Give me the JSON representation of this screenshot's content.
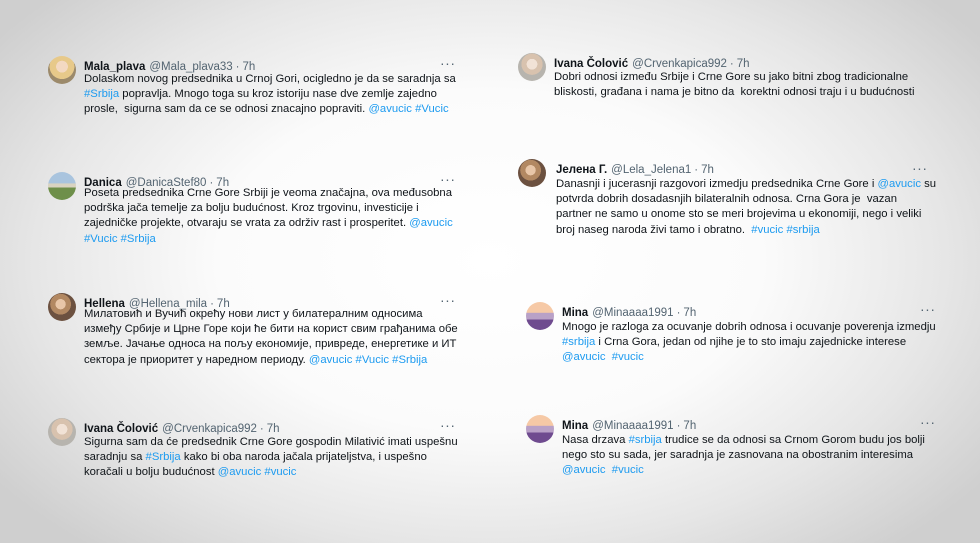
{
  "tweets": [
    {
      "name": "Mala_plava",
      "handle": "@Mala_plava33",
      "time": "7h",
      "avatar": "avatar-blonde",
      "lines": [
        [
          {
            "t": "Dolaskom novog predsednika u Crnoj Gori, ocigledno je da se saradnja sa"
          }
        ],
        [
          {
            "t": "#Srbija",
            "link": true
          },
          {
            "t": " popravlja. Mnogo toga su kroz istoriju nase dve zemlje zajedno"
          }
        ],
        [
          {
            "t": "prosle,  sigurna sam da ce se odnosi znacajno popraviti. "
          },
          {
            "t": "@avucic",
            "link": true
          },
          {
            "t": " "
          },
          {
            "t": "#Vucic",
            "link": true
          }
        ]
      ]
    },
    {
      "name": "Danica",
      "handle": "@DanicaStef80",
      "time": "7h",
      "avatar": "avatar-landscape",
      "lines": [
        [
          {
            "t": "Poseta predsednika Crne Gore Srbiji je veoma značajna, ova međusobna"
          }
        ],
        [
          {
            "t": "podrška jača temelje za bolju budućnost. Kroz trgovinu, investicije i"
          }
        ],
        [
          {
            "t": "zajedničke projekte, otvaraju se vrata za održiv rast i prosperitet. "
          },
          {
            "t": "@avucic",
            "link": true
          }
        ],
        [
          {
            "t": "#Vucic",
            "link": true
          },
          {
            "t": " "
          },
          {
            "t": "#Srbija",
            "link": true
          }
        ]
      ]
    },
    {
      "name": "Hellena",
      "handle": "@Hellena_mila",
      "time": "7h",
      "avatar": "avatar-photo",
      "lines": [
        [
          {
            "t": "Милатовић и Вучић окрећу нови лист у билатералним односима"
          }
        ],
        [
          {
            "t": "између Србије и Црне Горе који ће бити на корист свим грађанима обе"
          }
        ],
        [
          {
            "t": "земље. Јачање односа на пољу економије, привреде, енергетике и ИТ"
          }
        ],
        [
          {
            "t": "сектора је приоритет у наредном периоду. "
          },
          {
            "t": "@avucic",
            "link": true
          },
          {
            "t": " "
          },
          {
            "t": "#Vucic",
            "link": true
          },
          {
            "t": " "
          },
          {
            "t": "#Srbija",
            "link": true
          }
        ]
      ]
    },
    {
      "name": "Ivana Čolović",
      "handle": "@Crvenkapica992",
      "time": "7h",
      "avatar": "avatar-gray",
      "lines": [
        [
          {
            "t": "Sigurna sam da će predsednik Crne Gore gospodin Milativić imati uspešnu"
          }
        ],
        [
          {
            "t": "saradnju sa "
          },
          {
            "t": "#Srbija",
            "link": true
          },
          {
            "t": " kako bi oba naroda jačala prijateljstva, i uspešno"
          }
        ],
        [
          {
            "t": "koračali u bolju budućnost "
          },
          {
            "t": "@avucic",
            "link": true
          },
          {
            "t": " "
          },
          {
            "t": "#vucic",
            "link": true
          }
        ]
      ]
    },
    {
      "name": "Ivana Čolović",
      "handle": "@Crvenkapica992",
      "time": "7h",
      "avatar": "avatar-gray",
      "lines": [
        [
          {
            "t": "Dobri odnosi između Srbije i Crne Gore su jako bitni zbog tradicionalne"
          }
        ],
        [
          {
            "t": "bliskosti, građana i nama je bitno da  korektni odnosi traju i u budućnosti"
          }
        ]
      ]
    },
    {
      "name": "Јелена Г.",
      "handle": "@Lela_Jelena1",
      "time": "7h",
      "avatar": "avatar-photo",
      "lines": [
        [
          {
            "t": "Danasnji i jucerasnji razgovori izmedju predsednika Crne Gore i "
          },
          {
            "t": "@avucic",
            "link": true
          },
          {
            "t": " su"
          }
        ],
        [
          {
            "t": "potvrda dobrih dosadasnjih bilateralnih odnosa. Crna Gora je  vazan"
          }
        ],
        [
          {
            "t": "partner ne samo u onome sto se meri brojevima u ekonomiji, nego i veliki"
          }
        ],
        [
          {
            "t": "broj naseg naroda živi tamo i obratno.  "
          },
          {
            "t": "#vucic",
            "link": true
          },
          {
            "t": " "
          },
          {
            "t": "#srbija",
            "link": true
          }
        ]
      ]
    },
    {
      "name": "Mina",
      "handle": "@Minaaaa1991",
      "time": "7h",
      "avatar": "avatar-lavender",
      "lines": [
        [
          {
            "t": "Mnogo je razloga za ocuvanje dobrih odnosa i ocuvanje poverenja izmedju"
          }
        ],
        [
          {
            "t": "#srbija",
            "link": true
          },
          {
            "t": " i Crna Gora, jedan od njihe je to sto imaju zajednicke interese"
          }
        ],
        [
          {
            "t": "@avucic",
            "link": true
          },
          {
            "t": "  "
          },
          {
            "t": "#vucic",
            "link": true
          }
        ]
      ]
    },
    {
      "name": "Mina",
      "handle": "@Minaaaa1991",
      "time": "7h",
      "avatar": "avatar-lavender",
      "lines": [
        [
          {
            "t": "Nasa drzava "
          },
          {
            "t": "#srbija",
            "link": true
          },
          {
            "t": " trudice se da odnosi sa Crnom Gorom budu jos bolji"
          }
        ],
        [
          {
            "t": "nego sto su sada, jer saradnja je zasnovana na obostranim interesima"
          }
        ],
        [
          {
            "t": "@avucic",
            "link": true
          },
          {
            "t": "  "
          },
          {
            "t": "#vucic",
            "link": true
          }
        ]
      ]
    }
  ],
  "more_label": "···"
}
